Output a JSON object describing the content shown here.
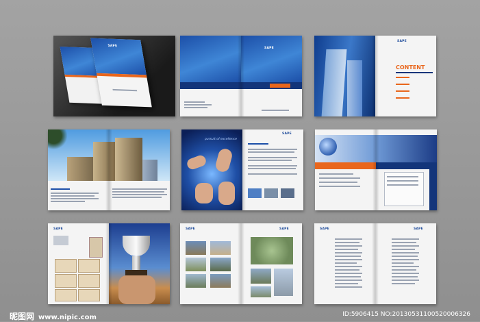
{
  "brand": {
    "logo_text": "SAPE",
    "accent_blue": "#1c4fa8",
    "accent_orange": "#e9661c"
  },
  "spreads": {
    "contents_title": "CONTENT",
    "pursuit_title": "pursuit of excellence"
  },
  "watermark": {
    "site_name": "昵图网",
    "site_url": "www.nipic.com",
    "id_text": "ID:5906415 NO:20130531100520006326"
  }
}
